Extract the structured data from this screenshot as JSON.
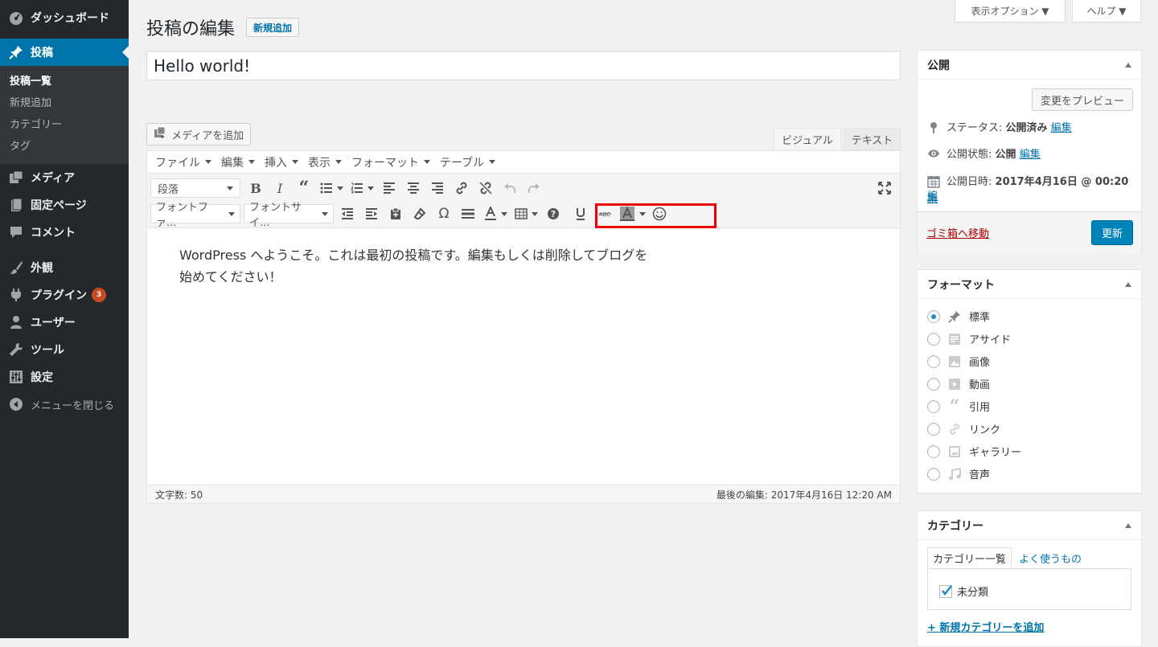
{
  "sidebar": {
    "items": [
      {
        "label": "ダッシュボード",
        "icon": "dashboard-icon"
      },
      {
        "label": "投稿",
        "icon": "pin-icon",
        "current": true
      },
      {
        "label": "メディア",
        "icon": "media-icon"
      },
      {
        "label": "固定ページ",
        "icon": "page-icon"
      },
      {
        "label": "コメント",
        "icon": "comment-icon"
      },
      {
        "label": "外観",
        "icon": "brush-icon"
      },
      {
        "label": "プラグイン",
        "icon": "plugin-icon",
        "badge": "3"
      },
      {
        "label": "ユーザー",
        "icon": "user-icon"
      },
      {
        "label": "ツール",
        "icon": "wrench-icon"
      },
      {
        "label": "設定",
        "icon": "settings-icon"
      },
      {
        "label": "メニューを閉じる",
        "icon": "collapse-icon"
      }
    ],
    "submenu": [
      "投稿一覧",
      "新規追加",
      "カテゴリー",
      "タグ"
    ]
  },
  "screen_meta": {
    "options": "表示オプション ▼",
    "help": "ヘルプ ▼"
  },
  "header": {
    "title": "投稿の編集",
    "add_new": "新規追加"
  },
  "post": {
    "title": "Hello world!"
  },
  "editor": {
    "media_button": "メディアを追加",
    "tabs": {
      "visual": "ビジュアル",
      "text": "テキスト"
    },
    "menubar": [
      "ファイル",
      "編集",
      "挿入",
      "表示",
      "フォーマット",
      "テーブル"
    ],
    "format_select": "段落",
    "font_family_select": "フォントファ...",
    "font_size_select": "フォントサイ...",
    "content_line1": "WordPress へようこそ。これは最初の投稿です。編集もしくは削除してブログを",
    "content_line2": "始めてください！",
    "word_count": "文字数: 50",
    "last_edited": "最後の編集: 2017年4月16日 12:20 AM"
  },
  "publish": {
    "heading": "公開",
    "preview": "変更をプレビュー",
    "status_label": "ステータス:",
    "status_value": "公開済み",
    "visibility_label": "公開状態:",
    "visibility_value": "公開",
    "date_label": "公開日時:",
    "date_value": "2017年4月16日 @ 00:20",
    "edit_link": "編集",
    "edit_link_wrapped_1": "編",
    "edit_link_wrapped_2": "集",
    "trash": "ゴミ箱へ移動",
    "update": "更新"
  },
  "format": {
    "heading": "フォーマット",
    "options": [
      "標準",
      "アサイド",
      "画像",
      "動画",
      "引用",
      "リンク",
      "ギャラリー",
      "音声"
    ],
    "selected": "標準"
  },
  "category": {
    "heading": "カテゴリー",
    "tab_all": "カテゴリー一覧",
    "tab_popular": "よく使うもの",
    "item": "未分類",
    "add_new": "+ 新規カテゴリーを追加"
  },
  "colors": {
    "accent": "#0073aa",
    "sidebar": "#23282d",
    "highlight": "#ee0000"
  }
}
